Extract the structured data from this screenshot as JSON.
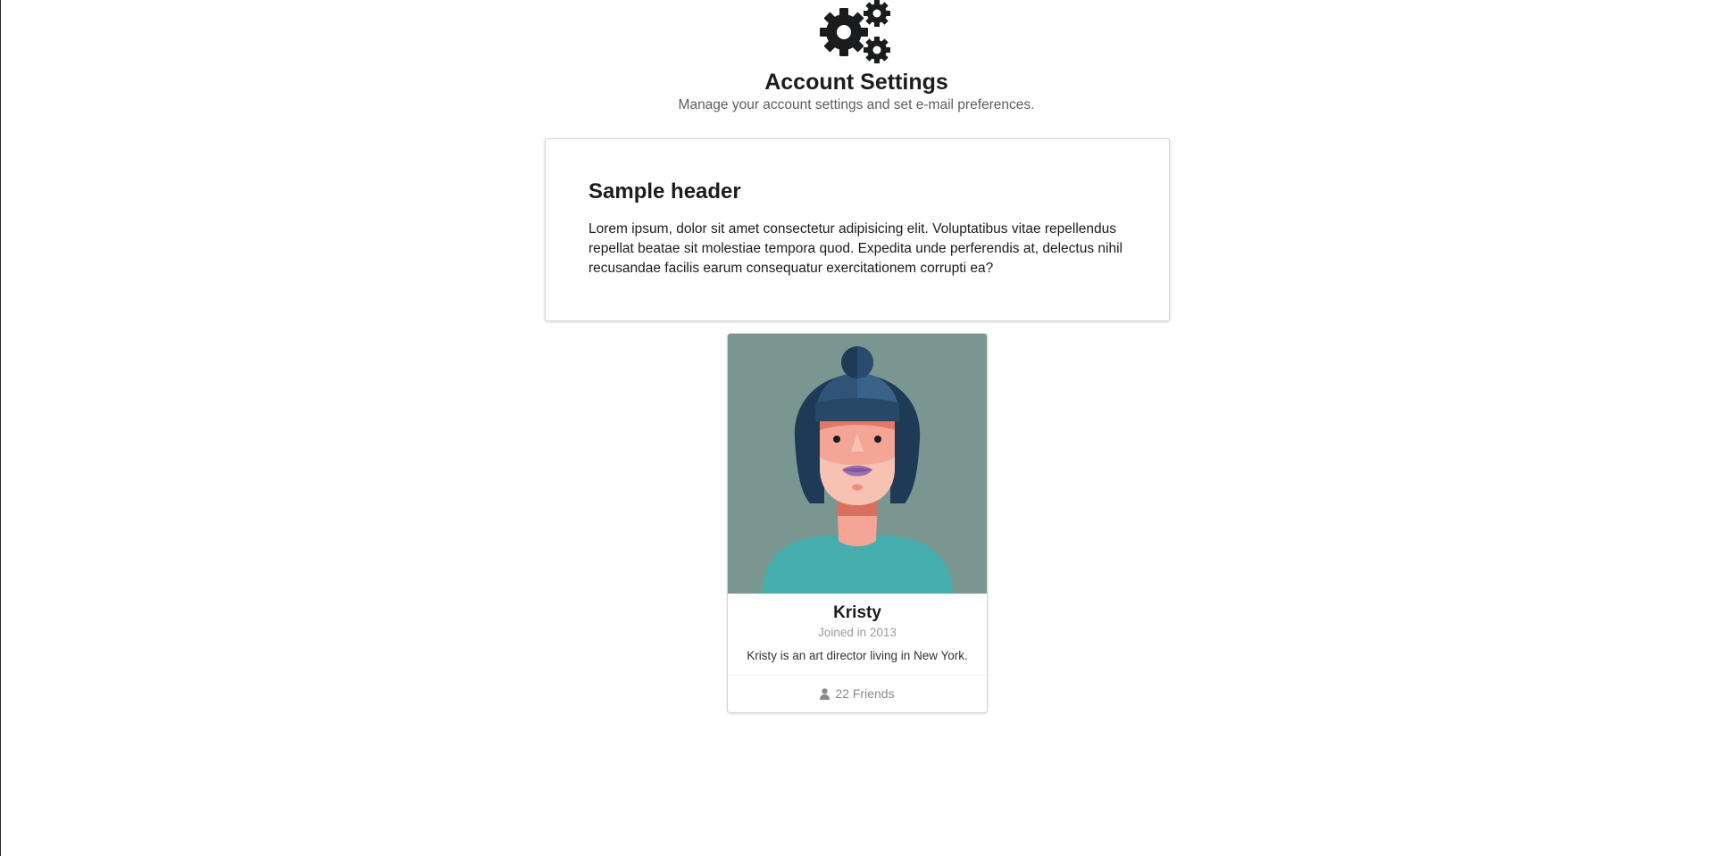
{
  "header": {
    "icon": "settings-gears-icon",
    "title": "Account Settings",
    "subtitle": "Manage your account settings and set e-mail preferences."
  },
  "segment": {
    "heading": "Sample header",
    "body": "Lorem ipsum, dolor sit amet consectetur adipisicing elit. Voluptatibus vitae repellendus repellat beatae sit molestiae tempora quod. Expedita unde perferendis at, delectus nihil recusandae facilis earum consequatur exercitationem corrupti ea?"
  },
  "profile_card": {
    "image_icon": "woman-avatar-illustration",
    "name": "Kristy",
    "meta": "Joined in 2013",
    "description": "Kristy is an art director living in New York.",
    "friends_icon": "user-icon",
    "friends_label": "22 Friends"
  },
  "colors": {
    "text": "#1b1c1d",
    "muted": "#5e5e5e",
    "avatar_bg": "#7a9690",
    "shirt": "#45aeac",
    "hair": "#1e3a56",
    "skin": "#f4a595"
  }
}
